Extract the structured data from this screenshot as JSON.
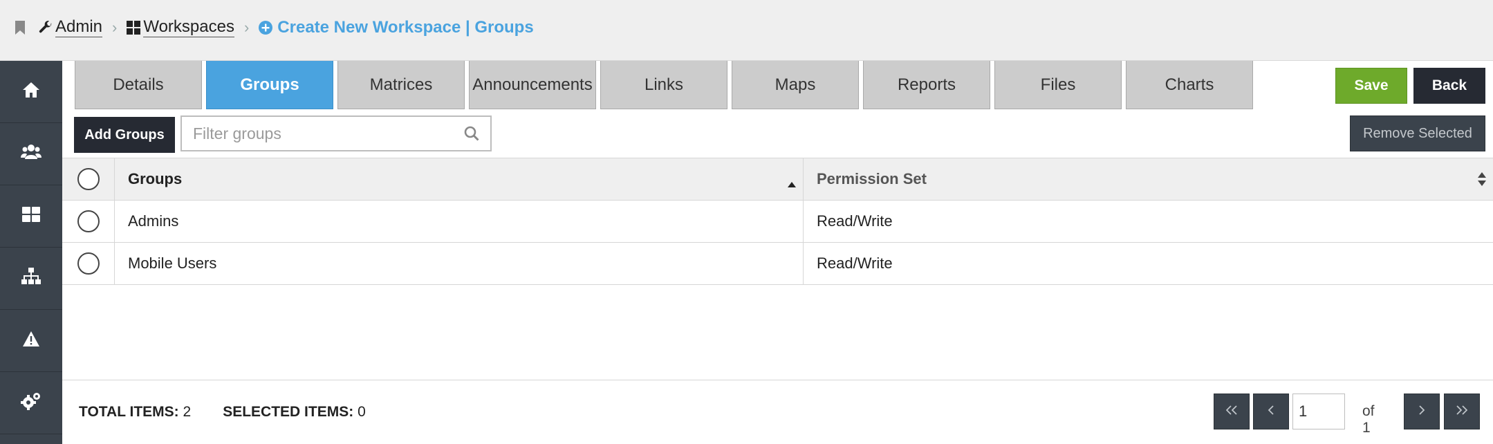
{
  "breadcrumb": {
    "admin": "Admin",
    "workspaces": "Workspaces",
    "current": "Create New Workspace | Groups",
    "accent": "#4aa3df"
  },
  "sidebar": {
    "items": [
      {
        "icon": "home-icon"
      },
      {
        "icon": "users-icon"
      },
      {
        "icon": "dashboard-icon"
      },
      {
        "icon": "sitemap-icon"
      },
      {
        "icon": "warning-icon"
      },
      {
        "icon": "settings-icon"
      }
    ]
  },
  "tabs": [
    {
      "label": "Details",
      "active": false
    },
    {
      "label": "Groups",
      "active": true
    },
    {
      "label": "Matrices",
      "active": false
    },
    {
      "label": "Announcements",
      "active": false
    },
    {
      "label": "Links",
      "active": false
    },
    {
      "label": "Maps",
      "active": false
    },
    {
      "label": "Reports",
      "active": false
    },
    {
      "label": "Files",
      "active": false
    },
    {
      "label": "Charts",
      "active": false
    }
  ],
  "actions": {
    "save": "Save",
    "back": "Back",
    "save_color": "#6eaa2b"
  },
  "toolbar": {
    "add_groups": "Add Groups",
    "filter_placeholder": "Filter groups",
    "remove_selected": "Remove Selected"
  },
  "table": {
    "columns": [
      "Groups",
      "Permission Set"
    ],
    "rows": [
      {
        "group": "Admins",
        "permission": "Read/Write"
      },
      {
        "group": "Mobile Users",
        "permission": "Read/Write"
      }
    ]
  },
  "footer": {
    "total_label": "TOTAL ITEMS:",
    "total_value": "2",
    "selected_label": "SELECTED ITEMS:",
    "selected_value": "0",
    "page_value": "1",
    "page_of": "of 1"
  }
}
